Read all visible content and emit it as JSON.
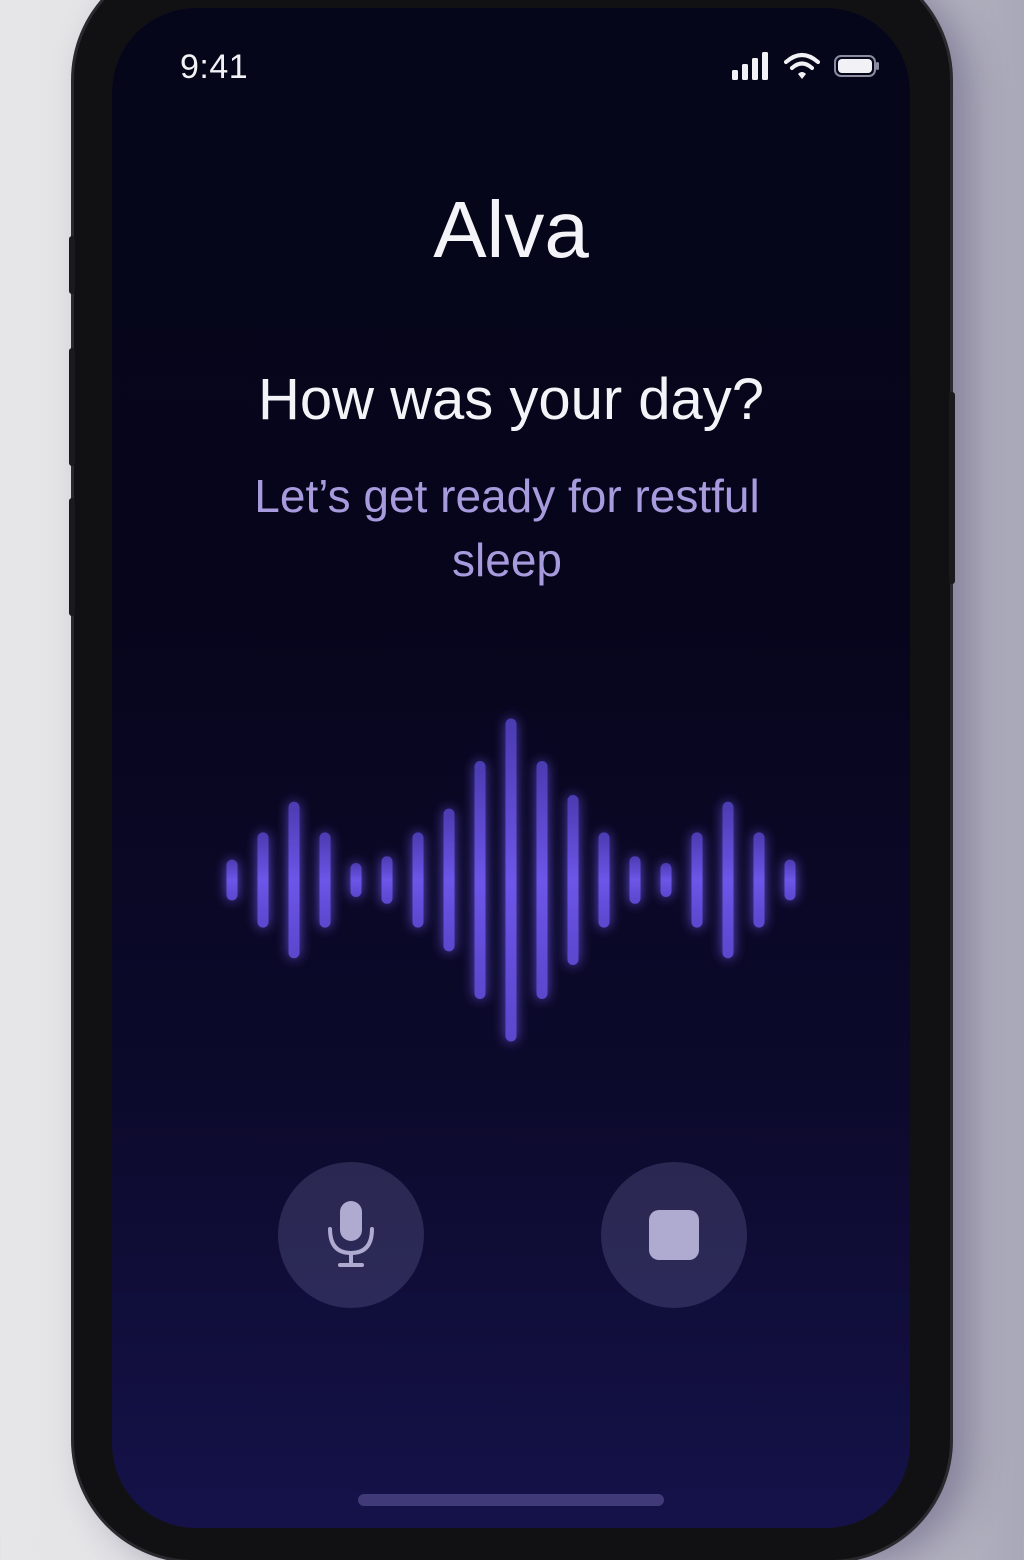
{
  "status_bar": {
    "time": "9:41",
    "icons": [
      "cellular-signal-icon",
      "wifi-icon",
      "battery-icon"
    ]
  },
  "app": {
    "title": "Alva",
    "question": "How was your day?",
    "subtitle": "Let’s get ready for restful sleep"
  },
  "waveform": {
    "bar_levels": [
      0.12,
      0.28,
      0.46,
      0.28,
      0.1,
      0.14,
      0.28,
      0.42,
      0.7,
      0.95,
      0.7,
      0.5,
      0.28,
      0.14,
      0.1,
      0.28,
      0.46,
      0.28,
      0.12
    ],
    "accent_color": "#6d55e8"
  },
  "controls": {
    "mic_icon": "microphone-icon",
    "stop_icon": "stop-icon"
  },
  "colors": {
    "background_top": "#06061a",
    "background_bottom": "#15124a",
    "subtitle": "#a79bde",
    "accent": "#6d55e8"
  }
}
